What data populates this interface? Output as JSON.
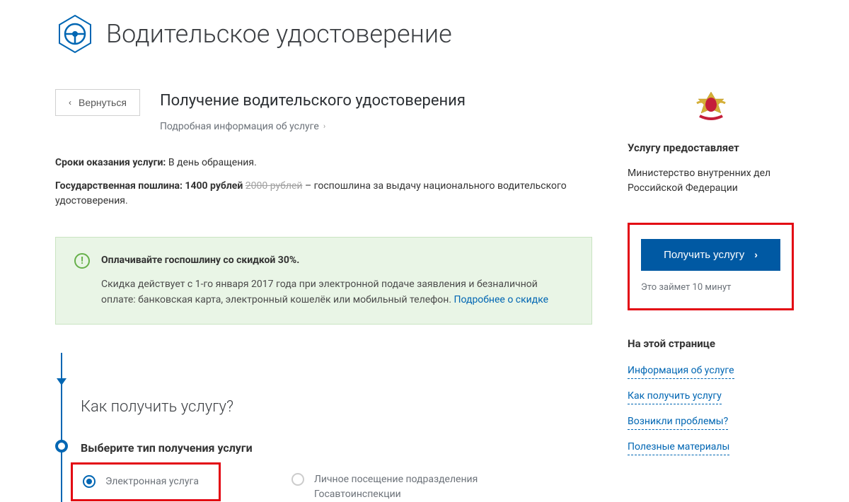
{
  "page": {
    "title": "Водительское удостоверение"
  },
  "back": {
    "label": "Вернуться"
  },
  "service": {
    "title": "Получение водительского удостоверения",
    "detail_link": "Подробная информация об услуге"
  },
  "timing": {
    "label": "Сроки оказания услуги:",
    "value": "В день обращения."
  },
  "fee": {
    "label": "Государственная пошлина:",
    "price": "1400 рублей",
    "old_price": "2000 рублей",
    "desc": "– госпошлина за выдачу национального водительского удостоверения."
  },
  "notice": {
    "title": "Оплачивайте госпошлину со скидкой 30%.",
    "text": "Скидка действует с 1-го января 2017 года при электронной подаче заявления и безналичной оплате: банковская карта, электронный кошелёк или мобильный телефон.",
    "link": "Подробнее о скидке"
  },
  "how": {
    "question": "Как получить услугу?",
    "step1_title": "Выберите тип получения услуги",
    "option1": "Электронная услуга",
    "option2": "Личное посещение подразделения Госавтоинспекции"
  },
  "provider": {
    "label": "Услугу предоставляет",
    "name": "Министерство внутренних дел Российской Федерации"
  },
  "cta": {
    "button": "Получить услугу",
    "sub": "Это займет 10 минут"
  },
  "pagenav": {
    "title": "На этой странице",
    "link1": "Информация об услуге",
    "link2": "Как получить услугу",
    "link3": "Возникли проблемы?",
    "link4": "Полезные материалы"
  }
}
